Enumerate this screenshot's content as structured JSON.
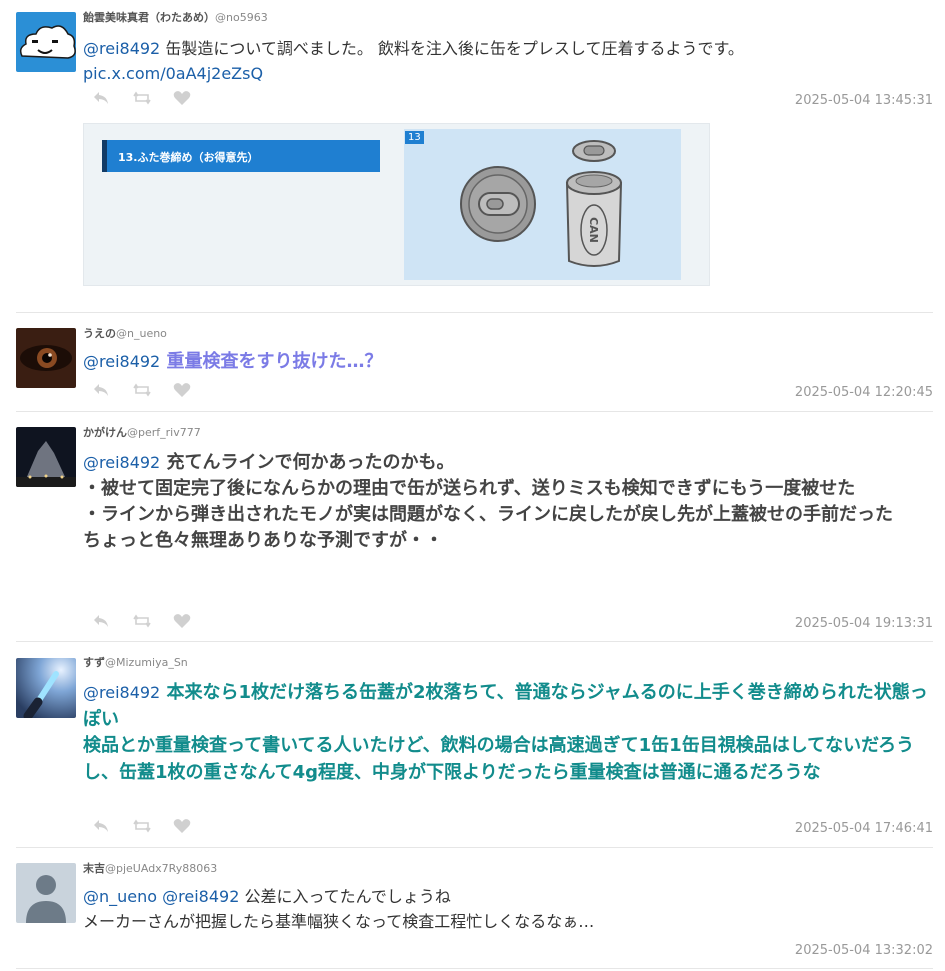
{
  "tweets": [
    {
      "display_name": "飴雲美味真君（わたあめ）",
      "handle": "@no5963",
      "mention": "@rei8492",
      "text": " 缶製造について調べました。 飲料を注入後に缶をプレスして圧着するようです。",
      "link": "pic.x.com/0aA4j2eZsQ",
      "time": "2025-05-04 13:45:31",
      "media": {
        "panel_title": "13.ふた巻締め（お得意先）",
        "panel_number": "13",
        "can_label": "CAN"
      }
    },
    {
      "display_name": "うえの",
      "handle": "@n_ueno",
      "mention": "@rei8492",
      "text": " 重量検査をすり抜けた…？",
      "time": "2025-05-04 12:20:45"
    },
    {
      "display_name": "かがけん",
      "handle": "@perf_riv777",
      "mention": "@rei8492",
      "text": " 充てんラインで何かあったのかも。\n・被せて固定完了後になんらかの理由で缶が送られず、送りミスも検知できずにもう一度被せた\n・ラインから弾き出されたモノが実は問題がなく、ラインに戻したが戻し先が上蓋被せの手前だった\nちょっと色々無理ありありな予測ですが・・",
      "time": "2025-05-04 19:13:31"
    },
    {
      "display_name": "すず",
      "handle": "@Mizumiya_Sn",
      "mention": "@rei8492",
      "text": " 本来なら1枚だけ落ちる缶蓋が2枚落ちて、普通ならジャムるのに上手く巻き締められた状態っぽい\n検品とか重量検査って書いてる人いたけど、飲料の場合は高速過ぎて1缶1缶目視検品はしてないだろうし、缶蓋1枚の重さなんて4g程度、中身が下限よりだったら重量検査は普通に通るだろうな",
      "time": "2025-05-04 17:46:41"
    },
    {
      "display_name": "末吉",
      "handle": "@pjeUAdx7Ry88063",
      "mention": "@n_ueno @rei8492",
      "text": " 公差に入ってたんでしょうね\nメーカーさんが把握したら基準幅狭くなって検査工程忙しくなるなぁ…",
      "time": "2025-05-04 13:32:02"
    }
  ],
  "icons": {
    "reply": "reply-icon",
    "retweet": "retweet-icon",
    "like": "heart-icon"
  },
  "colors": {
    "mention": "#1b5fa8",
    "purple_text": "#7b7be6",
    "teal_text": "#128c8c",
    "icon_gray": "#d0d0d0"
  }
}
